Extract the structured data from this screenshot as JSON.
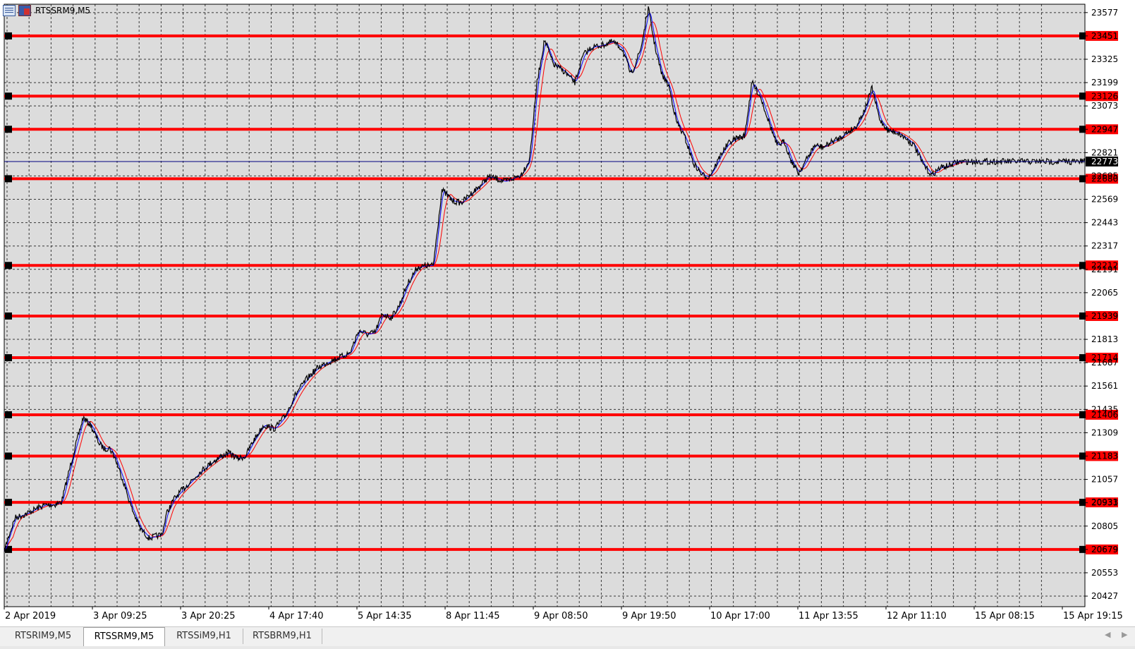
{
  "window": {
    "title": "RTSSRM9,M5"
  },
  "tabs": [
    {
      "label": "RTSRIM9,M5",
      "active": false
    },
    {
      "label": "RTSSRM9,M5",
      "active": true
    },
    {
      "label": "RTSSiM9,H1",
      "active": false
    },
    {
      "label": "RTSBRM9,H1",
      "active": false
    }
  ],
  "icons": [
    "chart-window-icon",
    "scroll-left-icon",
    "scroll-right-icon"
  ],
  "colors": {
    "chart_background": "#dcdcdc",
    "grid": "#000000",
    "price_line": "#000000",
    "fast_ma": "#0000ff",
    "slow_ma": "#ff0000",
    "level_lines": "#ff0000",
    "current_price_line": "#000080",
    "current_price_label_bg": "#000000"
  },
  "chart_data": {
    "type": "line",
    "symbol": "RTSSRM9",
    "timeframe": "M5",
    "y_ticks": [
      23577,
      23451,
      23325,
      23199,
      23073,
      22947,
      22821,
      22695,
      22569,
      22443,
      22317,
      22191,
      22065,
      21939,
      21813,
      21687,
      21561,
      21435,
      21309,
      21183,
      21057,
      20931,
      20805,
      20679,
      20553,
      20427
    ],
    "x_ticks": [
      "2 Apr 2019",
      "3 Apr 09:25",
      "3 Apr 20:25",
      "4 Apr 17:40",
      "5 Apr 14:35",
      "8 Apr 11:45",
      "9 Apr 08:50",
      "9 Apr 19:50",
      "10 Apr 17:00",
      "11 Apr 13:55",
      "12 Apr 11:10",
      "15 Apr 08:15",
      "15 Apr 19:15"
    ],
    "ylim": [
      20370,
      23622
    ],
    "grid": true,
    "current_price": 22773,
    "horizontal_levels": [
      23451,
      23126,
      22947,
      22680,
      22212,
      21939,
      21714,
      21406,
      21183,
      20933,
      20679
    ],
    "series": [
      {
        "type": "price",
        "x": [
          0,
          0.3,
          1.0,
          2.0,
          3.0,
          3.8,
          4.6,
          5.3,
          6.2,
          7.3,
          8.0,
          8.8,
          9.3,
          9.7,
          10.2,
          11.0,
          11.8,
          12.6,
          13.4,
          14.0,
          14.6,
          15.0,
          15.7,
          16.3,
          17.0,
          18.0,
          19.0,
          20.0,
          20.8,
          21.6,
          22.3,
          23.0,
          24.0,
          25.0,
          26.0,
          27.0,
          28.0,
          29.0,
          30.0,
          31.0,
          32.0,
          32.8,
          33.6,
          34.3,
          35.0,
          35.8,
          36.5,
          37.3,
          38.2,
          39.0,
          39.7,
          40.5,
          41.5,
          42.3,
          43.2,
          44.0,
          44.8,
          45.6,
          46.3,
          47.0,
          47.8,
          48.6,
          49.3,
          50.0,
          50.8,
          51.8,
          52.8,
          53.6,
          54.4,
          55.3,
          56.3,
          57.2,
          58.0,
          58.9,
          59.6,
          60.2,
          60.8,
          61.5,
          62.2,
          63.0,
          63.8,
          64.6,
          65.2,
          65.8,
          66.4,
          67.0,
          67.8,
          68.5,
          69.2,
          70.0,
          70.8,
          71.5,
          72.2,
          72.8,
          73.5,
          74.3,
          75.0,
          75.8,
          76.6,
          77.3,
          78.0,
          78.8,
          79.6,
          80.3,
          81.0,
          81.8,
          82.6,
          83.4,
          84.2,
          85.0,
          85.8,
          86.6,
          87.4,
          88.2,
          89.0,
          89.8,
          90.6,
          91.4,
          92.2,
          93.0,
          93.8,
          94.6,
          95.4,
          96.2,
          97.0,
          97.8,
          98.6,
          99.3,
          100.0
        ],
        "y": [
          20670,
          20730,
          20850,
          20870,
          20900,
          20920,
          20920,
          20935,
          21150,
          21390,
          21350,
          21250,
          21220,
          21230,
          21180,
          21050,
          20900,
          20790,
          20740,
          20750,
          20760,
          20870,
          20950,
          20990,
          21030,
          21090,
          21140,
          21180,
          21200,
          21170,
          21180,
          21260,
          21350,
          21330,
          21400,
          21520,
          21600,
          21660,
          21690,
          21715,
          21740,
          21860,
          21840,
          21850,
          21950,
          21930,
          21990,
          22110,
          22200,
          22210,
          22212,
          22620,
          22560,
          22550,
          22600,
          22640,
          22690,
          22680,
          22665,
          22680,
          22700,
          22780,
          23200,
          23430,
          23300,
          23260,
          23200,
          23350,
          23390,
          23400,
          23420,
          23380,
          23240,
          23380,
          23600,
          23400,
          23250,
          23180,
          22990,
          22900,
          22760,
          22700,
          22690,
          22750,
          22820,
          22870,
          22900,
          22910,
          23200,
          23120,
          22980,
          22860,
          22880,
          22780,
          22710,
          22790,
          22860,
          22850,
          22880,
          22900,
          22930,
          22960,
          23050,
          23170,
          23000,
          22940,
          22930,
          22900,
          22860,
          22760,
          22700,
          22740,
          22750,
          22770,
          22773,
          22773,
          22773,
          22773,
          22773,
          22773,
          22773,
          22773,
          22773,
          22773,
          22773,
          22773,
          22773,
          22773,
          22773
        ]
      }
    ]
  }
}
